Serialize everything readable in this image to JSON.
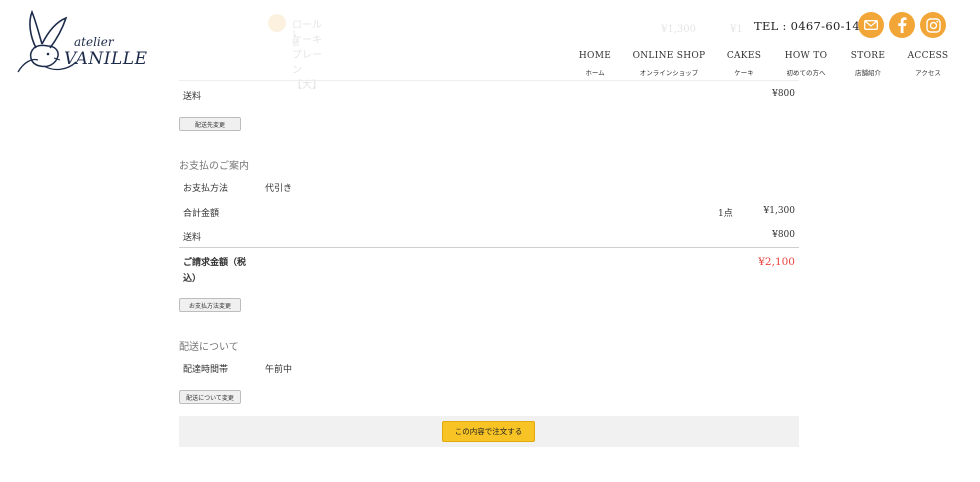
{
  "header": {
    "logo_text": "atelier VANILLE",
    "tel": "TEL : 0467-60-1432",
    "nav": [
      {
        "en": "HOME",
        "ja": "ホーム"
      },
      {
        "en": "ONLINE SHOP",
        "ja": "オンラインショップ"
      },
      {
        "en": "CAKES",
        "ja": "ケーキ"
      },
      {
        "en": "HOW TO",
        "ja": "初めての方へ"
      },
      {
        "en": "STORE",
        "ja": "店舗紹介"
      },
      {
        "en": "ACCESS",
        "ja": "アクセス"
      }
    ],
    "sns_icons": [
      "mail-icon",
      "facebook-icon",
      "instagram-icon"
    ],
    "accent_color": "#f2a637"
  },
  "faded": {
    "product_name": "ロールケーキ プレーン【大】",
    "product_sub": "1個",
    "product_price": "¥1,300"
  },
  "shipping_top": {
    "label": "送料",
    "value": "¥800",
    "button": "配送先変更"
  },
  "payment": {
    "section_title": "お支払のご案内",
    "method_label": "お支払方法",
    "method_value": "代引き",
    "total_label": "合計金額",
    "total_qty": "1点",
    "total_value": "¥1,300",
    "shipping_label": "送料",
    "shipping_value": "¥800",
    "billing_label_1": "ご請求金額（税",
    "billing_label_2": "込）",
    "billing_value": "¥2,100",
    "button": "お支払方法変更"
  },
  "delivery": {
    "section_title": "配送について",
    "time_label": "配達時間帯",
    "time_value": "午前中",
    "button": "配送について変更"
  },
  "order_button": "この内容で注文する"
}
